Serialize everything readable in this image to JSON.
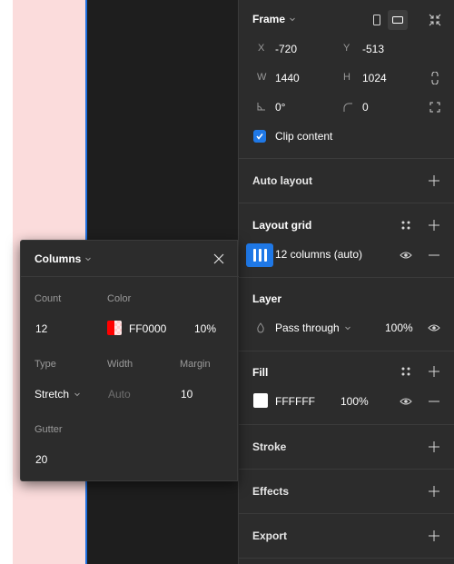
{
  "frame": {
    "title": "Frame",
    "x_label": "X",
    "x_value": "-720",
    "y_label": "Y",
    "y_value": "-513",
    "w_label": "W",
    "w_value": "1440",
    "h_label": "H",
    "h_value": "1024",
    "rotation_value": "0°",
    "radius_value": "0",
    "clip_label": "Clip content",
    "clip_checked": true
  },
  "auto_layout": {
    "title": "Auto layout"
  },
  "layout_grid": {
    "title": "Layout grid",
    "item_label": "12 columns (auto)"
  },
  "layer": {
    "title": "Layer",
    "blend_mode": "Pass through",
    "opacity": "100%"
  },
  "fill": {
    "title": "Fill",
    "hex": "FFFFFF",
    "opacity": "100%",
    "color": "#FFFFFF"
  },
  "stroke": {
    "title": "Stroke"
  },
  "effects": {
    "title": "Effects"
  },
  "export": {
    "title": "Export"
  },
  "grid_popup": {
    "title": "Columns",
    "count_label": "Count",
    "count_value": "12",
    "color_label": "Color",
    "color_hex": "FF0000",
    "color_opacity": "10%",
    "type_label": "Type",
    "type_value": "Stretch",
    "width_label": "Width",
    "width_placeholder": "Auto",
    "margin_label": "Margin",
    "margin_value": "10",
    "gutter_label": "Gutter",
    "gutter_value": "20"
  },
  "colors": {
    "accent": "#1F78E6",
    "grid_color": "#FF0000",
    "frame_preview": "#FBDCDC"
  }
}
